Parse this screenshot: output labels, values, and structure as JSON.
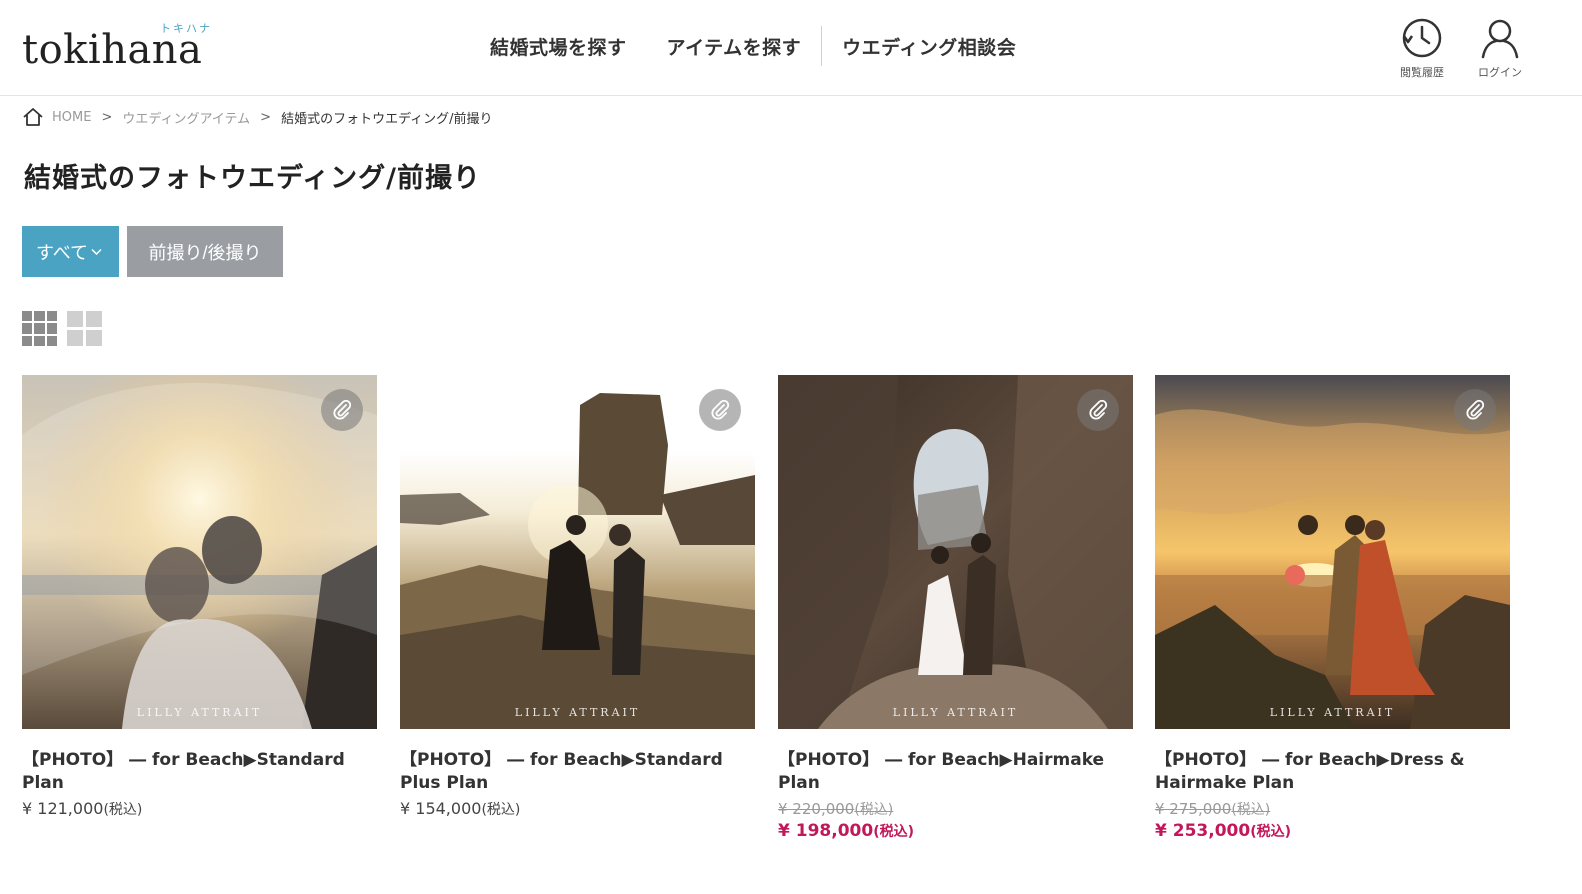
{
  "header": {
    "logo_text": "tokihana",
    "logo_ruby": "トキハナ",
    "nav": [
      "結婚式場を探す",
      "アイテムを探す",
      "ウエディング相談会"
    ],
    "history_label": "閲覧履歴",
    "login_label": "ログイン"
  },
  "breadcrumb": {
    "home": "HOME",
    "sep": ">",
    "level1": "ウエディングアイテム",
    "current": "結婚式のフォトウエディング/前撮り"
  },
  "page_title": "結婚式のフォトウエディング/前撮り",
  "filters": {
    "all_label": "すべて",
    "photo_label": "前撮り/後撮り"
  },
  "colors": {
    "accent": "#4aa3c3",
    "chip_inactive": "#9a9ea3",
    "sale": "#c2185b"
  },
  "watermark": "LILLY ATTRAIT",
  "cards": [
    {
      "title": "【PHOTO】 ― for Beach▶Standard Plan",
      "price": "¥ 121,000",
      "tax": "(税込)"
    },
    {
      "title": "【PHOTO】 ― for Beach▶Standard Plus Plan",
      "price": "¥ 154,000",
      "tax": "(税込)"
    },
    {
      "title": "【PHOTO】 ― for Beach▶Hairmake Plan",
      "price_old": "¥ 220,000",
      "tax_old": "(税込)",
      "price": "¥ 198,000",
      "tax": "(税込)"
    },
    {
      "title": "【PHOTO】 ― for Beach▶Dress & Hairmake Plan",
      "price_old": "¥ 275,000",
      "tax_old": "(税込)",
      "price": "¥ 253,000",
      "tax": "(税込)"
    }
  ]
}
